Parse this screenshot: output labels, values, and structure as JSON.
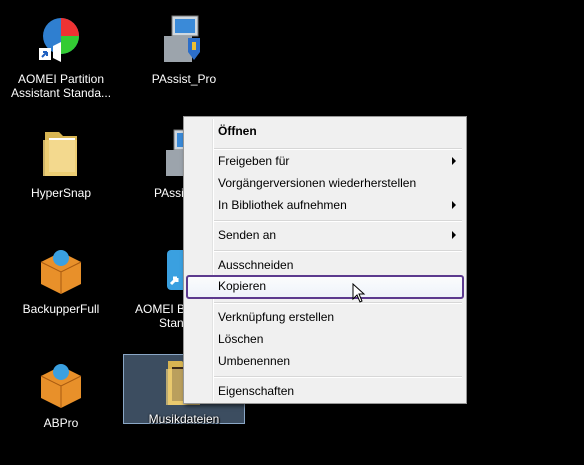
{
  "desktop": {
    "icons": [
      {
        "label_line1": "AOMEI Partition",
        "label_line2": "Assistant Standa...",
        "icon": "aomei-partition-icon"
      },
      {
        "label_line1": "PAssist_Pro",
        "icon": "installer-icon"
      },
      {
        "label_line1": "HyperSnap",
        "icon": "folder-icon"
      },
      {
        "label_line1": "PAssi",
        "icon": "installer-icon"
      },
      {
        "label_line1": "BackupperFull",
        "icon": "package-icon"
      },
      {
        "label_line1": "AOMEI B",
        "label_line2": "Stan",
        "icon": "aomei-backupper-icon"
      },
      {
        "label_line1": "ABPro",
        "icon": "package-icon"
      },
      {
        "label_line1": "Musikdateien",
        "icon": "music-folder-icon"
      }
    ]
  },
  "context_menu": {
    "open": "Öffnen",
    "share": "Freigeben für",
    "prev_versions": "Vorgängerversionen wiederherstellen",
    "library": "In Bibliothek aufnehmen",
    "send_to": "Senden an",
    "cut": "Ausschneiden",
    "copy": "Kopieren",
    "shortcut": "Verknüpfung erstellen",
    "delete": "Löschen",
    "rename": "Umbenennen",
    "properties": "Eigenschaften"
  },
  "colors": {
    "background": "#000000",
    "menu_bg": "#f0f0f0",
    "hover_border": "#5c3a8e",
    "selection": "#6e8caf"
  }
}
